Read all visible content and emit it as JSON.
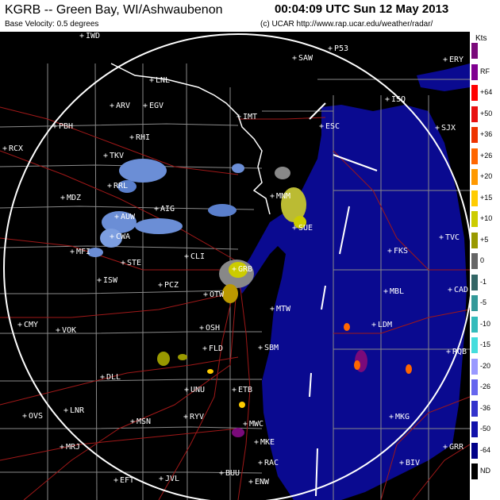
{
  "header": {
    "title": "KGRB -- Green Bay, WI/Ashwaubenon",
    "subtitle": "Base Velocity: 0.5 degrees",
    "timestamp": "00:04:09 UTC Sun 12 May 2013",
    "credit": "(c) UCAR  http://www.rap.ucar.edu/weather/radar/"
  },
  "legend": {
    "units": "Kts",
    "entries": [
      {
        "label": "",
        "color": "#7a0a7a"
      },
      {
        "label": "RF",
        "color": "#800090"
      },
      {
        "label": "+64",
        "color": "#ff0000"
      },
      {
        "label": "+50",
        "color": "#e81010"
      },
      {
        "label": "+36",
        "color": "#ee3300"
      },
      {
        "label": "+26",
        "color": "#ff6600"
      },
      {
        "label": "+20",
        "color": "#ff9900"
      },
      {
        "label": "+15",
        "color": "#ffcc00"
      },
      {
        "label": "+10",
        "color": "#cccc00"
      },
      {
        "label": "+5",
        "color": "#999900"
      },
      {
        "label": "0",
        "color": "#666666"
      },
      {
        "label": "-1",
        "color": "#336666"
      },
      {
        "label": "-5",
        "color": "#339999"
      },
      {
        "label": "-10",
        "color": "#33bbbb"
      },
      {
        "label": "-15",
        "color": "#44dddd"
      },
      {
        "label": "-20",
        "color": "#9999ff"
      },
      {
        "label": "-26",
        "color": "#6666ee"
      },
      {
        "label": "-36",
        "color": "#3333cc"
      },
      {
        "label": "-50",
        "color": "#1111aa"
      },
      {
        "label": "-64",
        "color": "#000088"
      },
      {
        "label": "ND",
        "color": "#000000"
      }
    ]
  },
  "map": {
    "radar_center_site": "GRB",
    "sites": [
      {
        "id": "IWD"
      },
      {
        "id": "SAW"
      },
      {
        "id": "P53"
      },
      {
        "id": "ERY"
      },
      {
        "id": "LNL"
      },
      {
        "id": "ARV"
      },
      {
        "id": "EGV"
      },
      {
        "id": "ISQ"
      },
      {
        "id": "IMT"
      },
      {
        "id": "ESC"
      },
      {
        "id": "PBH"
      },
      {
        "id": "RHI"
      },
      {
        "id": "SJX"
      },
      {
        "id": "RCX"
      },
      {
        "id": "TKV"
      },
      {
        "id": "RRL"
      },
      {
        "id": "MNM"
      },
      {
        "id": "MDZ"
      },
      {
        "id": "AIG"
      },
      {
        "id": "AUW"
      },
      {
        "id": "CWA"
      },
      {
        "id": "SUE"
      },
      {
        "id": "TVC"
      },
      {
        "id": "MFI"
      },
      {
        "id": "CLI"
      },
      {
        "id": "FKS"
      },
      {
        "id": "STE"
      },
      {
        "id": "GRB"
      },
      {
        "id": "ISW"
      },
      {
        "id": "PCZ"
      },
      {
        "id": "CAD"
      },
      {
        "id": "OTW"
      },
      {
        "id": "MBL"
      },
      {
        "id": "MTW"
      },
      {
        "id": "CMY"
      },
      {
        "id": "VOK"
      },
      {
        "id": "OSH"
      },
      {
        "id": "LDM"
      },
      {
        "id": "FLD"
      },
      {
        "id": "SBM"
      },
      {
        "id": "RQB"
      },
      {
        "id": "DLL"
      },
      {
        "id": "UNU"
      },
      {
        "id": "ETB"
      },
      {
        "id": "LNR"
      },
      {
        "id": "OVS"
      },
      {
        "id": "MSN"
      },
      {
        "id": "RYV"
      },
      {
        "id": "MKG"
      },
      {
        "id": "MWC"
      },
      {
        "id": "MRJ"
      },
      {
        "id": "MKE"
      },
      {
        "id": "GRR"
      },
      {
        "id": "RAC"
      },
      {
        "id": "BIV"
      },
      {
        "id": "EFT"
      },
      {
        "id": "JVL"
      },
      {
        "id": "BUU"
      },
      {
        "id": "ENW"
      }
    ]
  }
}
